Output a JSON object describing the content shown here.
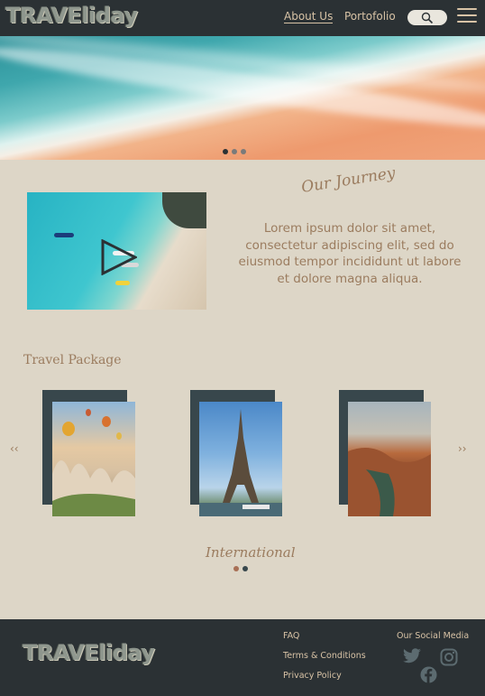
{
  "header": {
    "logo": "TRAVEliday",
    "nav": {
      "about": "About Us",
      "portfolio": "Portofolio"
    },
    "icons": {
      "search": "search-icon",
      "menu": "hamburger-menu-icon"
    }
  },
  "hero": {
    "image": "aerial-beach-waves",
    "dots": [
      "#2b3134",
      "#7a7a7a",
      "#7a7a7a"
    ]
  },
  "journey": {
    "title": "Our Journey",
    "text": "Lorem ipsum dolor sit amet, consectetur adipiscing elit, sed do eiusmod tempor incididunt ut labore et dolore magna aliqua.",
    "video_icon": "play-icon"
  },
  "packages": {
    "title": "Travel Package",
    "prev": "‹‹",
    "next": "››",
    "cards": [
      {
        "image": "cappadocia-balloons"
      },
      {
        "image": "eiffel-tower"
      },
      {
        "image": "canyon-river"
      }
    ],
    "category": "International",
    "dots": [
      "#a86f55",
      "#38474c"
    ]
  },
  "footer": {
    "logo": "TRAVEliday",
    "links": [
      "FAQ",
      "Terms & Conditions",
      "Privacy Policy"
    ],
    "social_title": "Our Social Media",
    "social_icons": [
      "twitter-icon",
      "instagram-icon",
      "facebook-icon"
    ]
  },
  "colors": {
    "background": "#ddd6c7",
    "dark": "#2b3134",
    "accent": "#9b7c5f",
    "nav_text": "#d8c3a6"
  }
}
